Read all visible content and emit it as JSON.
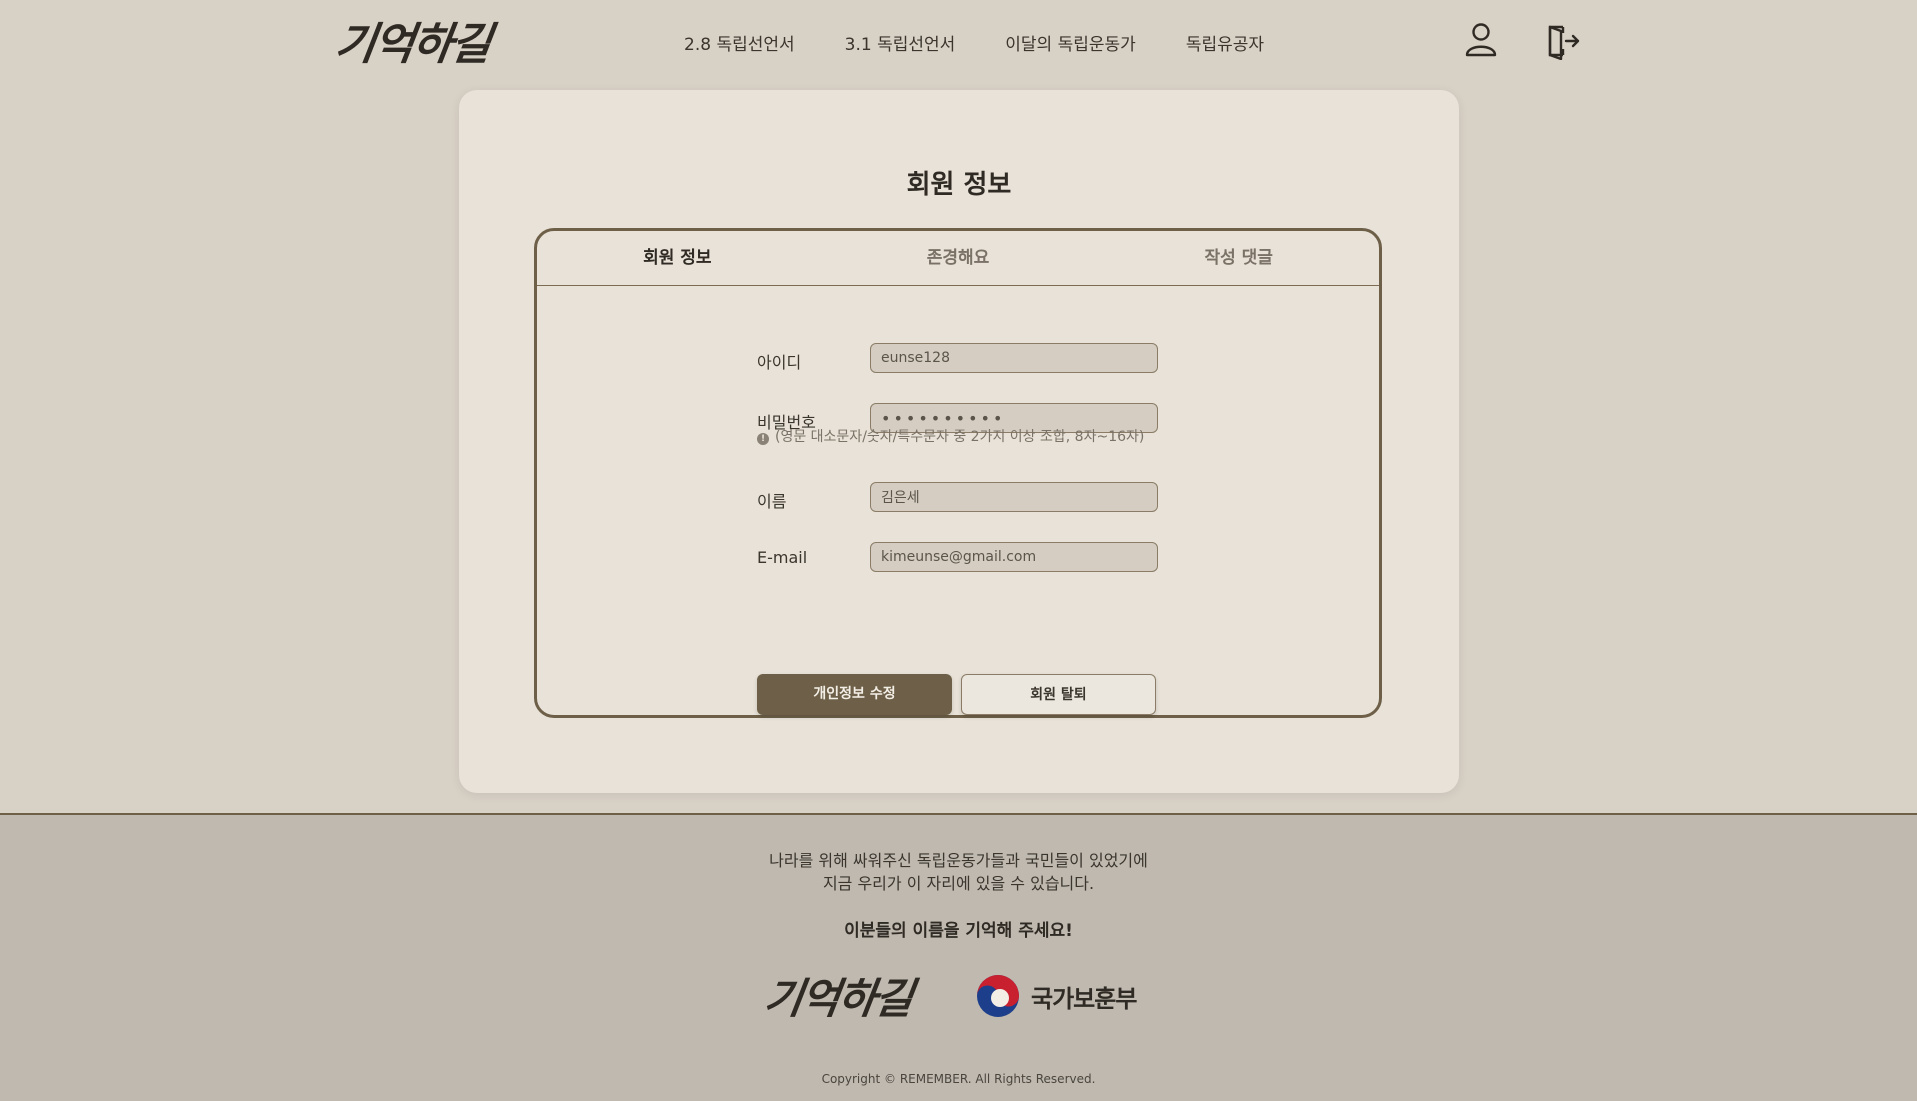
{
  "header": {
    "logo_text": "기억하길",
    "nav": [
      "2.8 독립선언서",
      "3.1 독립선언서",
      "이달의 독립운동가",
      "독립유공자"
    ],
    "user_icon": "user-icon",
    "logout_icon": "logout-icon"
  },
  "main": {
    "title": "회원 정보",
    "tabs": [
      "회원 정보",
      "존경해요",
      "작성 댓글"
    ],
    "active_tab": "회원 정보",
    "form": {
      "id_label": "아이디",
      "id_value": "eunse128",
      "password_label": "비밀번호",
      "password_value": "••••••••••",
      "password_hint": "(영문 대소문자/숫자/특수문자 중 2가지 이상 조합, 8자~16자)",
      "name_label": "이름",
      "name_value": "김은세",
      "email_label": "E-mail",
      "email_value": "kimeunse@gmail.com"
    },
    "buttons": {
      "edit": "개인정보 수정",
      "withdraw": "회원 탈퇴"
    }
  },
  "footer": {
    "line1": "나라를 위해 싸워주신 독립운동가들과 국민들이 있었기에",
    "line2": "지금 우리가 이 자리에 있을 수 있습니다.",
    "emphasis": "이분들의 이름을 기억해 주세요!",
    "logo_text": "기억하길",
    "gov_name": "국가보훈부",
    "copyright": "Copyright © REMEMBER. All Rights Reserved."
  },
  "colors": {
    "background": "#d8d1c6",
    "card": "#e8e2d8",
    "accent": "#6e6048",
    "footer": "#bfb9b0"
  }
}
